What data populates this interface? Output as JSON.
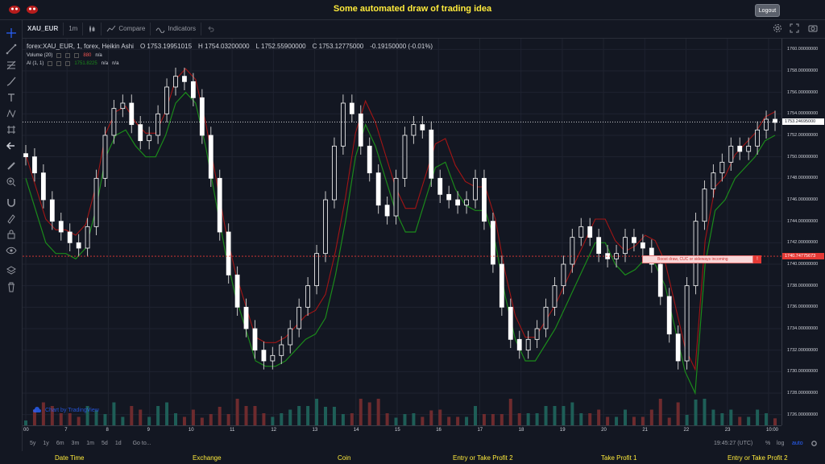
{
  "header": {
    "title": "Some automated draw of trading idea",
    "logout_label": "Logout"
  },
  "toolbar": {
    "symbol": "XAU_EUR",
    "interval": "1m",
    "compare_label": "Compare",
    "indicators_label": "Indicators"
  },
  "legend": {
    "series": "forex:XAU_EUR, 1, forex, Heikin Ashi",
    "open": "O 1753.19951015",
    "high": "H 1754.03200000",
    "low": "L 1752.55900000",
    "close": "C 1753.12775000",
    "change": "-0.19150000 (-0.01%)",
    "volume_label": "Volume (20)",
    "volume_value": "880",
    "volume_na": "n/a",
    "ai_label": "AI (1, 1)",
    "ai_value": "1751.8225",
    "ai_na1": "n/a",
    "ai_na2": "n/a"
  },
  "price_axis": {
    "ticks": [
      "1760.00000000",
      "1758.00000000",
      "1756.00000000",
      "1754.00000000",
      "1752.00000000",
      "1750.00000000",
      "1748.00000000",
      "1746.00000000",
      "1744.00000000",
      "1742.00000000",
      "1740.00000000",
      "1738.00000000",
      "1736.00000000",
      "1734.00000000",
      "1732.00000000",
      "1730.00000000",
      "1728.00000000",
      "1726.00000000"
    ],
    "current_price": "1753.24695000",
    "signal_price": "1740.74775673"
  },
  "time_axis": {
    "ticks": [
      "00",
      "7",
      "8",
      "9",
      "10",
      "11",
      "12",
      "13",
      "14",
      "15",
      "16",
      "17",
      "18",
      "19",
      "20",
      "21",
      "22",
      "23",
      "10:00"
    ]
  },
  "signal": {
    "text": "Boost draw, CUC or sideways incoming",
    "button": "!"
  },
  "watermark": "Chart by TradingView",
  "bottombar": {
    "ranges": [
      "5y",
      "1y",
      "6m",
      "3m",
      "1m",
      "5d",
      "1d"
    ],
    "goto": "Go to...",
    "time": "19:45:27 (UTC)",
    "percent": "%",
    "log": "log",
    "auto": "auto"
  },
  "footer": {
    "labels": [
      "Date Time",
      "Exchange",
      "Coin",
      "Entry or Take Profit 2",
      "Take Profit 1",
      "Entry or Take Profit 2"
    ]
  },
  "colors": {
    "accent": "#ffeb3b",
    "up": "#26a69a",
    "down": "#ef5350",
    "candle": "#ffffff",
    "ai_line": "#1b8a1b",
    "red_line": "#a31515"
  },
  "chart_data": {
    "type": "line",
    "series": [
      {
        "name": "Heikin Ashi",
        "values": [
          1750.0,
          1748.5,
          1746.0,
          1744.0,
          1743.0,
          1742.0,
          1741.5,
          1743.5,
          1748.0,
          1752.0,
          1754.5,
          1755.0,
          1753.0,
          1751.5,
          1752.0,
          1754.0,
          1756.5,
          1757.5,
          1757.0,
          1755.5,
          1752.0,
          1748.0,
          1743.0,
          1739.0,
          1736.0,
          1734.0,
          1732.0,
          1731.0,
          1731.5,
          1732.5,
          1734.0,
          1736.0,
          1738.0,
          1741.0,
          1746.0,
          1751.0,
          1755.0,
          1754.0,
          1751.0,
          1748.5,
          1745.5,
          1744.5,
          1748.0,
          1752.0,
          1753.0,
          1752.5,
          1748.0,
          1746.5,
          1746.0,
          1745.5,
          1746.0,
          1748.0,
          1744.0,
          1740.0,
          1736.0,
          1733.0,
          1732.0,
          1733.0,
          1734.0,
          1736.0,
          1738.0,
          1740.0,
          1742.5,
          1743.5,
          1742.5,
          1741.0,
          1740.5,
          1741.0,
          1742.5,
          1742.0,
          1741.5,
          1740.0,
          1737.0,
          1733.5,
          1731.0,
          1738.0,
          1744.0,
          1747.0,
          1748.5,
          1749.5,
          1751.0,
          1750.5,
          1751.0,
          1752.5,
          1753.5,
          1753.2
        ]
      },
      {
        "name": "AI (1, 1)",
        "values": [
          1748.0,
          1745.0,
          1742.0,
          1741.0,
          1741.0,
          1740.5,
          1741.5,
          1745.0,
          1750.0,
          1752.0,
          1752.5,
          1751.0,
          1750.0,
          1750.0,
          1752.0,
          1755.0,
          1756.0,
          1755.0,
          1751.0,
          1746.0,
          1741.0,
          1737.0,
          1734.0,
          1731.0,
          1730.5,
          1730.5,
          1731.0,
          1732.0,
          1733.0,
          1733.5,
          1735.0,
          1739.0,
          1744.0,
          1750.0,
          1753.0,
          1751.0,
          1748.0,
          1745.0,
          1743.0,
          1743.0,
          1746.0,
          1749.0,
          1749.5,
          1747.0,
          1745.5,
          1745.0,
          1745.0,
          1742.0,
          1737.0,
          1733.0,
          1731.0,
          1731.0,
          1732.5,
          1734.0,
          1736.0,
          1738.0,
          1740.0,
          1742.0,
          1742.0,
          1740.0,
          1739.0,
          1739.5,
          1740.5,
          1740.0,
          1738.0,
          1734.0,
          1730.0,
          1728.0,
          1740.0,
          1745.0,
          1746.0,
          1748.0,
          1749.0,
          1750.0,
          1751.5,
          1752.0
        ]
      }
    ],
    "ylim": [
      1725,
      1761
    ]
  }
}
